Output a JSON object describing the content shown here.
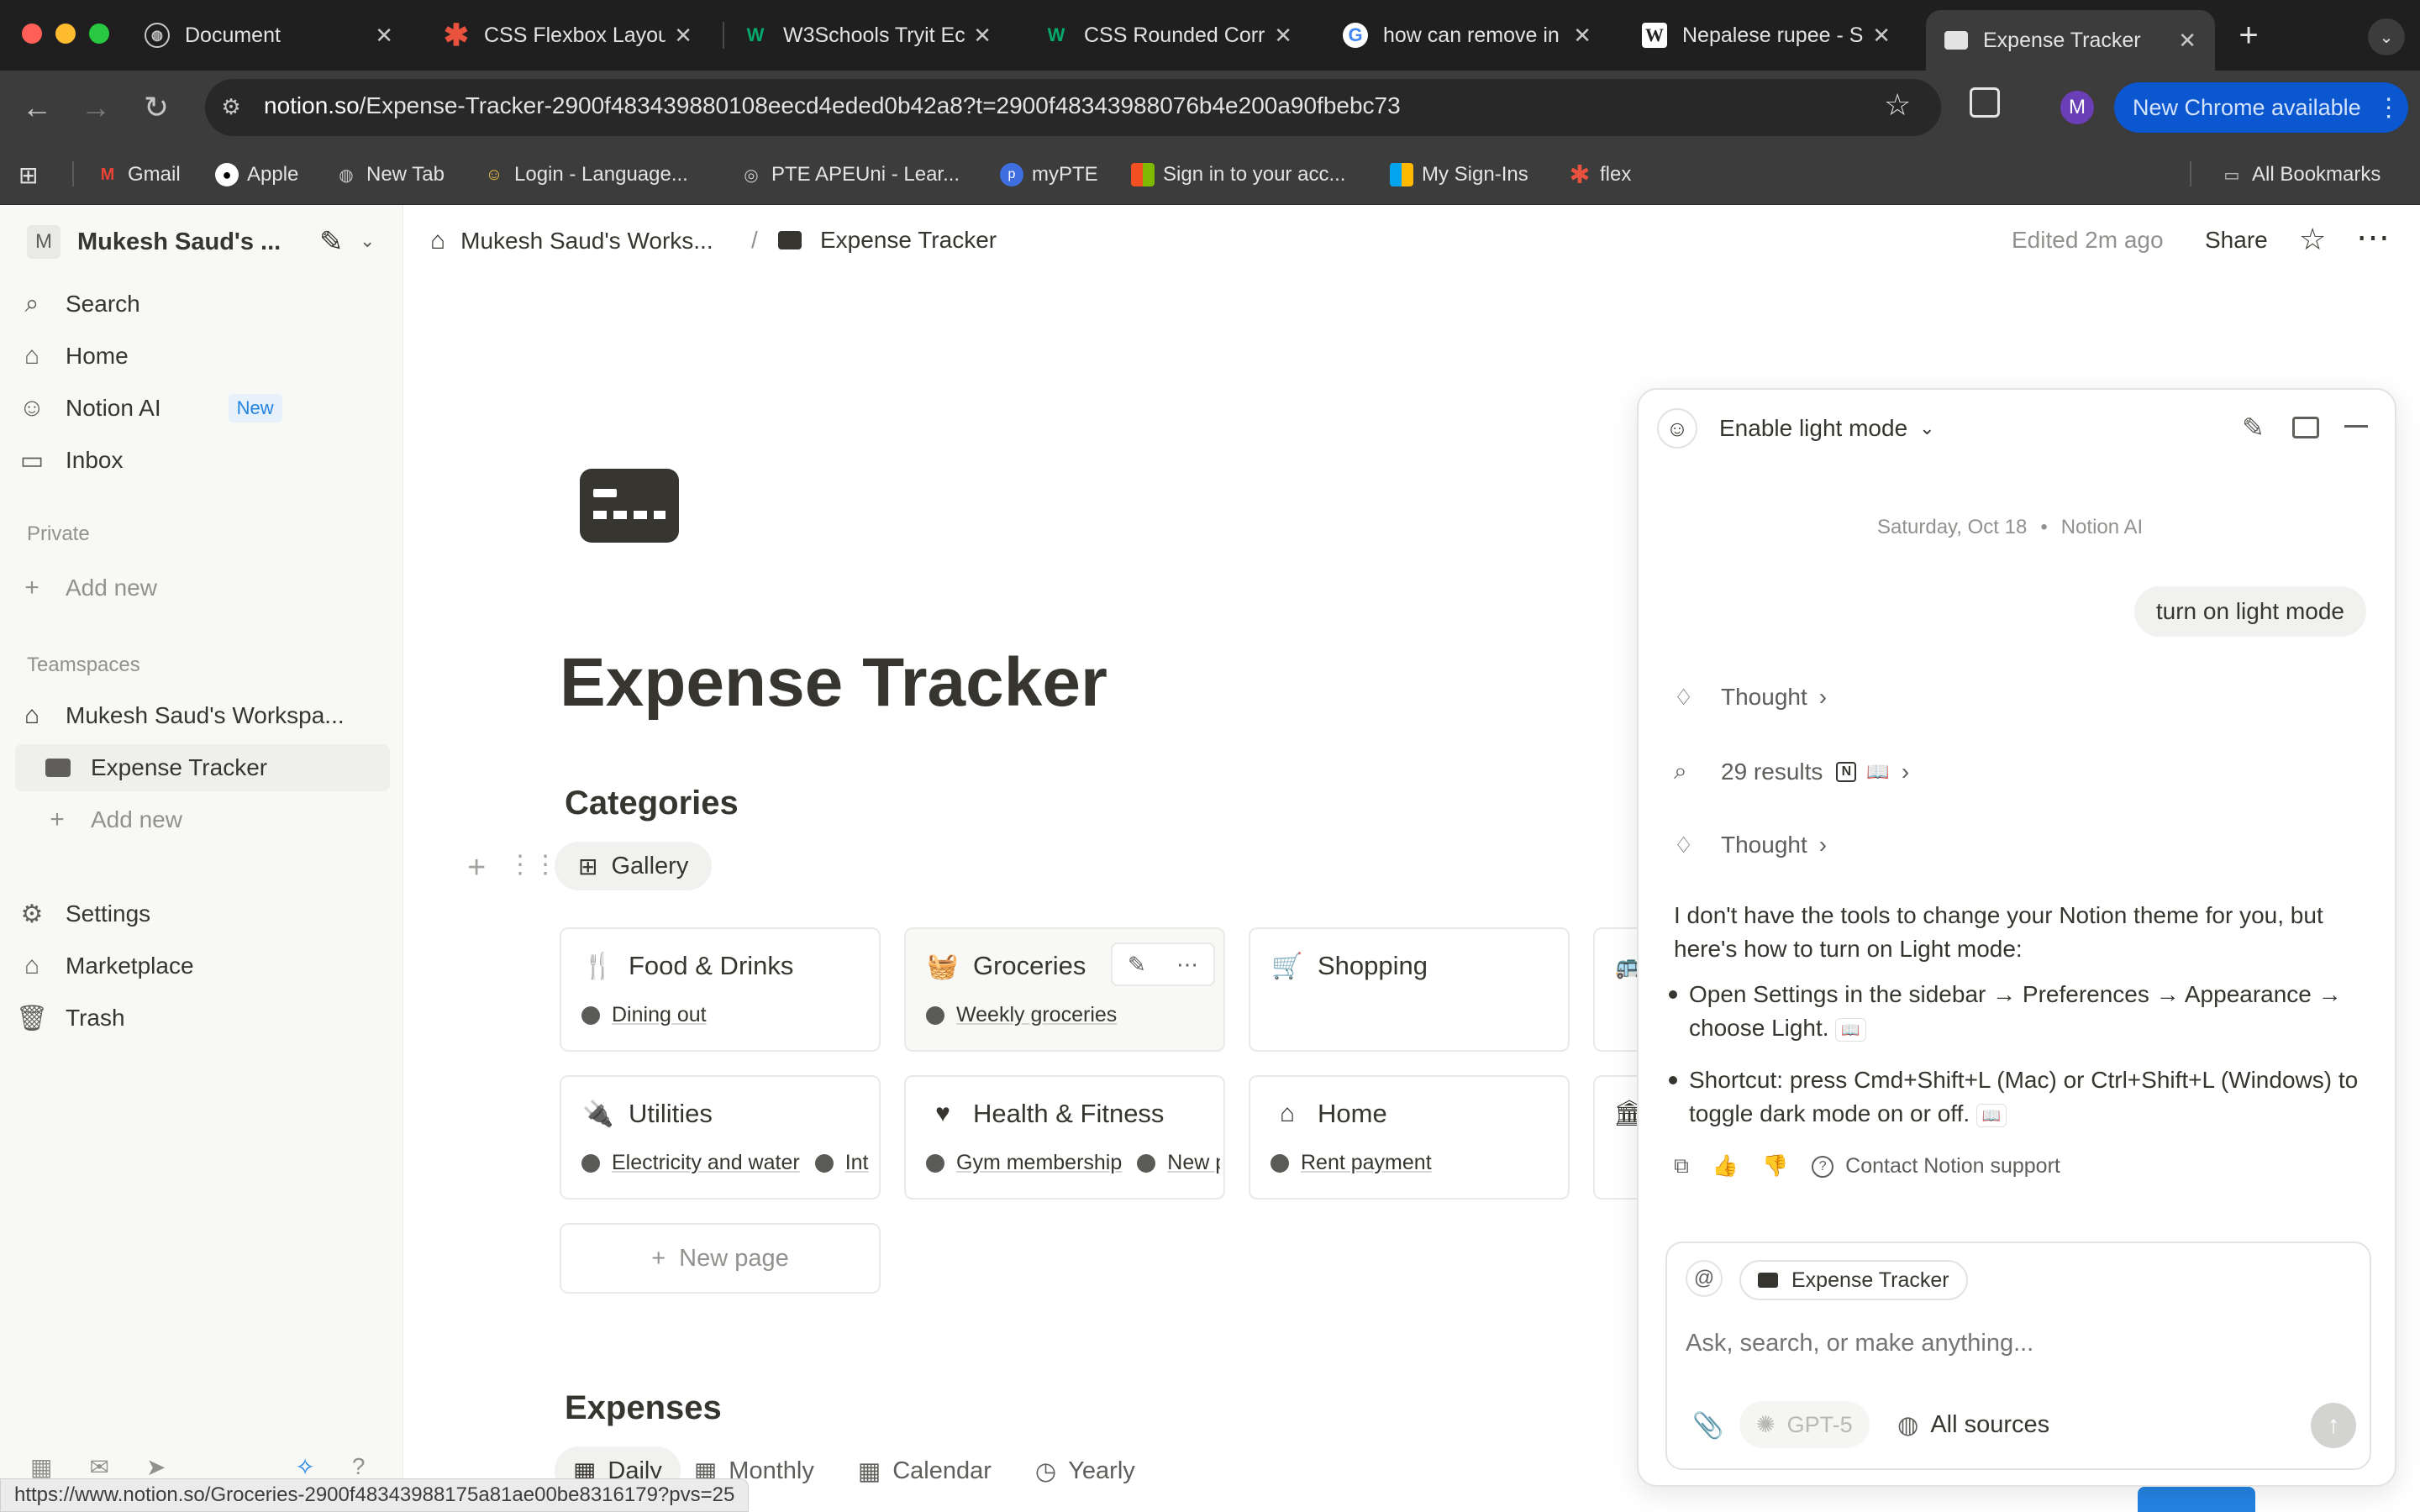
{
  "browser": {
    "tabs": [
      {
        "title": "Document",
        "icon": "globe-icon"
      },
      {
        "title": "CSS Flexbox Layou",
        "icon": "asterisk-icon"
      },
      {
        "title": "W3Schools Tryit Ec",
        "icon": "w3schools-icon"
      },
      {
        "title": "CSS Rounded Corr",
        "icon": "w3schools-icon"
      },
      {
        "title": "how can remove in",
        "icon": "google-icon"
      },
      {
        "title": "Nepalese rupee - S",
        "icon": "wikipedia-icon"
      },
      {
        "title": "Expense Tracker",
        "icon": "notion-page-icon"
      }
    ],
    "url_host": "notion.so",
    "url_path": "/Expense-Tracker-2900f483439880108eecd4eded0b42a8?t=2900f48343988076b4e200a90fbebc73",
    "profile_initial": "M",
    "update_label": "New Chrome available",
    "bookmarks": [
      "Gmail",
      "Apple",
      "New Tab",
      "Login - Language...",
      "PTE APEUni - Lear...",
      "myPTE",
      "Sign in to your acc...",
      "My Sign-Ins",
      "flex"
    ],
    "all_bookmarks": "All Bookmarks",
    "status_url": "https://www.notion.so/Groceries-2900f48343988175a81ae00be8316179?pvs=25"
  },
  "sidebar": {
    "workspace_initial": "M",
    "workspace_name": "Mukesh Saud's ...",
    "nav": [
      {
        "label": "Search"
      },
      {
        "label": "Home"
      },
      {
        "label": "Notion AI",
        "badge": "New"
      },
      {
        "label": "Inbox"
      }
    ],
    "private_heading": "Private",
    "private_add": "Add new",
    "teamspaces_heading": "Teamspaces",
    "teamspace_name": "Mukesh Saud's Workspa...",
    "teamspace_page": "Expense Tracker",
    "teamspace_add": "Add new",
    "footer": [
      {
        "label": "Settings"
      },
      {
        "label": "Marketplace"
      },
      {
        "label": "Trash"
      }
    ]
  },
  "topbar": {
    "crumb_workspace": "Mukesh Saud's Works...",
    "crumb_separator": "/",
    "crumb_page": "Expense Tracker",
    "edited": "Edited 2m ago",
    "share": "Share"
  },
  "page": {
    "title": "Expense Tracker",
    "categories_heading": "Categories",
    "view_label": "Gallery",
    "cards_row1": [
      {
        "title": "Food & Drinks",
        "tags": [
          "Dining out"
        ]
      },
      {
        "title": "Groceries",
        "tags": [
          "Weekly groceries"
        ]
      },
      {
        "title": "Shopping",
        "tags": []
      }
    ],
    "cards_row2": [
      {
        "title": "Utilities",
        "tags": [
          "Electricity and water",
          "Int"
        ]
      },
      {
        "title": "Health & Fitness",
        "tags": [
          "Gym membership",
          "New p"
        ]
      },
      {
        "title": "Home",
        "tags": [
          "Rent payment"
        ]
      }
    ],
    "new_page": "New page",
    "expenses_heading": "Expenses",
    "expense_views": [
      "Daily",
      "Monthly",
      "Calendar",
      "Yearly"
    ]
  },
  "ai_panel": {
    "chat_title": "Enable light mode",
    "date": "Saturday, Oct 18",
    "author": "Notion AI",
    "user_message": "turn on light mode",
    "thought_1": "Thought",
    "results": "29 results",
    "thought_2": "Thought",
    "response_intro": "I don't have the tools to change your Notion theme for you, but here's how to turn on Light mode:",
    "bullet_1": "Open Settings in the sidebar → Preferences → Appearance → choose Light.",
    "bullet_2": "Shortcut: press Cmd+Shift+L (Mac) or Ctrl+Shift+L (Windows) to toggle dark mode on or off.",
    "support_link": "Contact Notion support",
    "context_chip": "Expense Tracker",
    "input_placeholder": "Ask, search, or make anything...",
    "model": "GPT-5",
    "sources": "All sources"
  }
}
